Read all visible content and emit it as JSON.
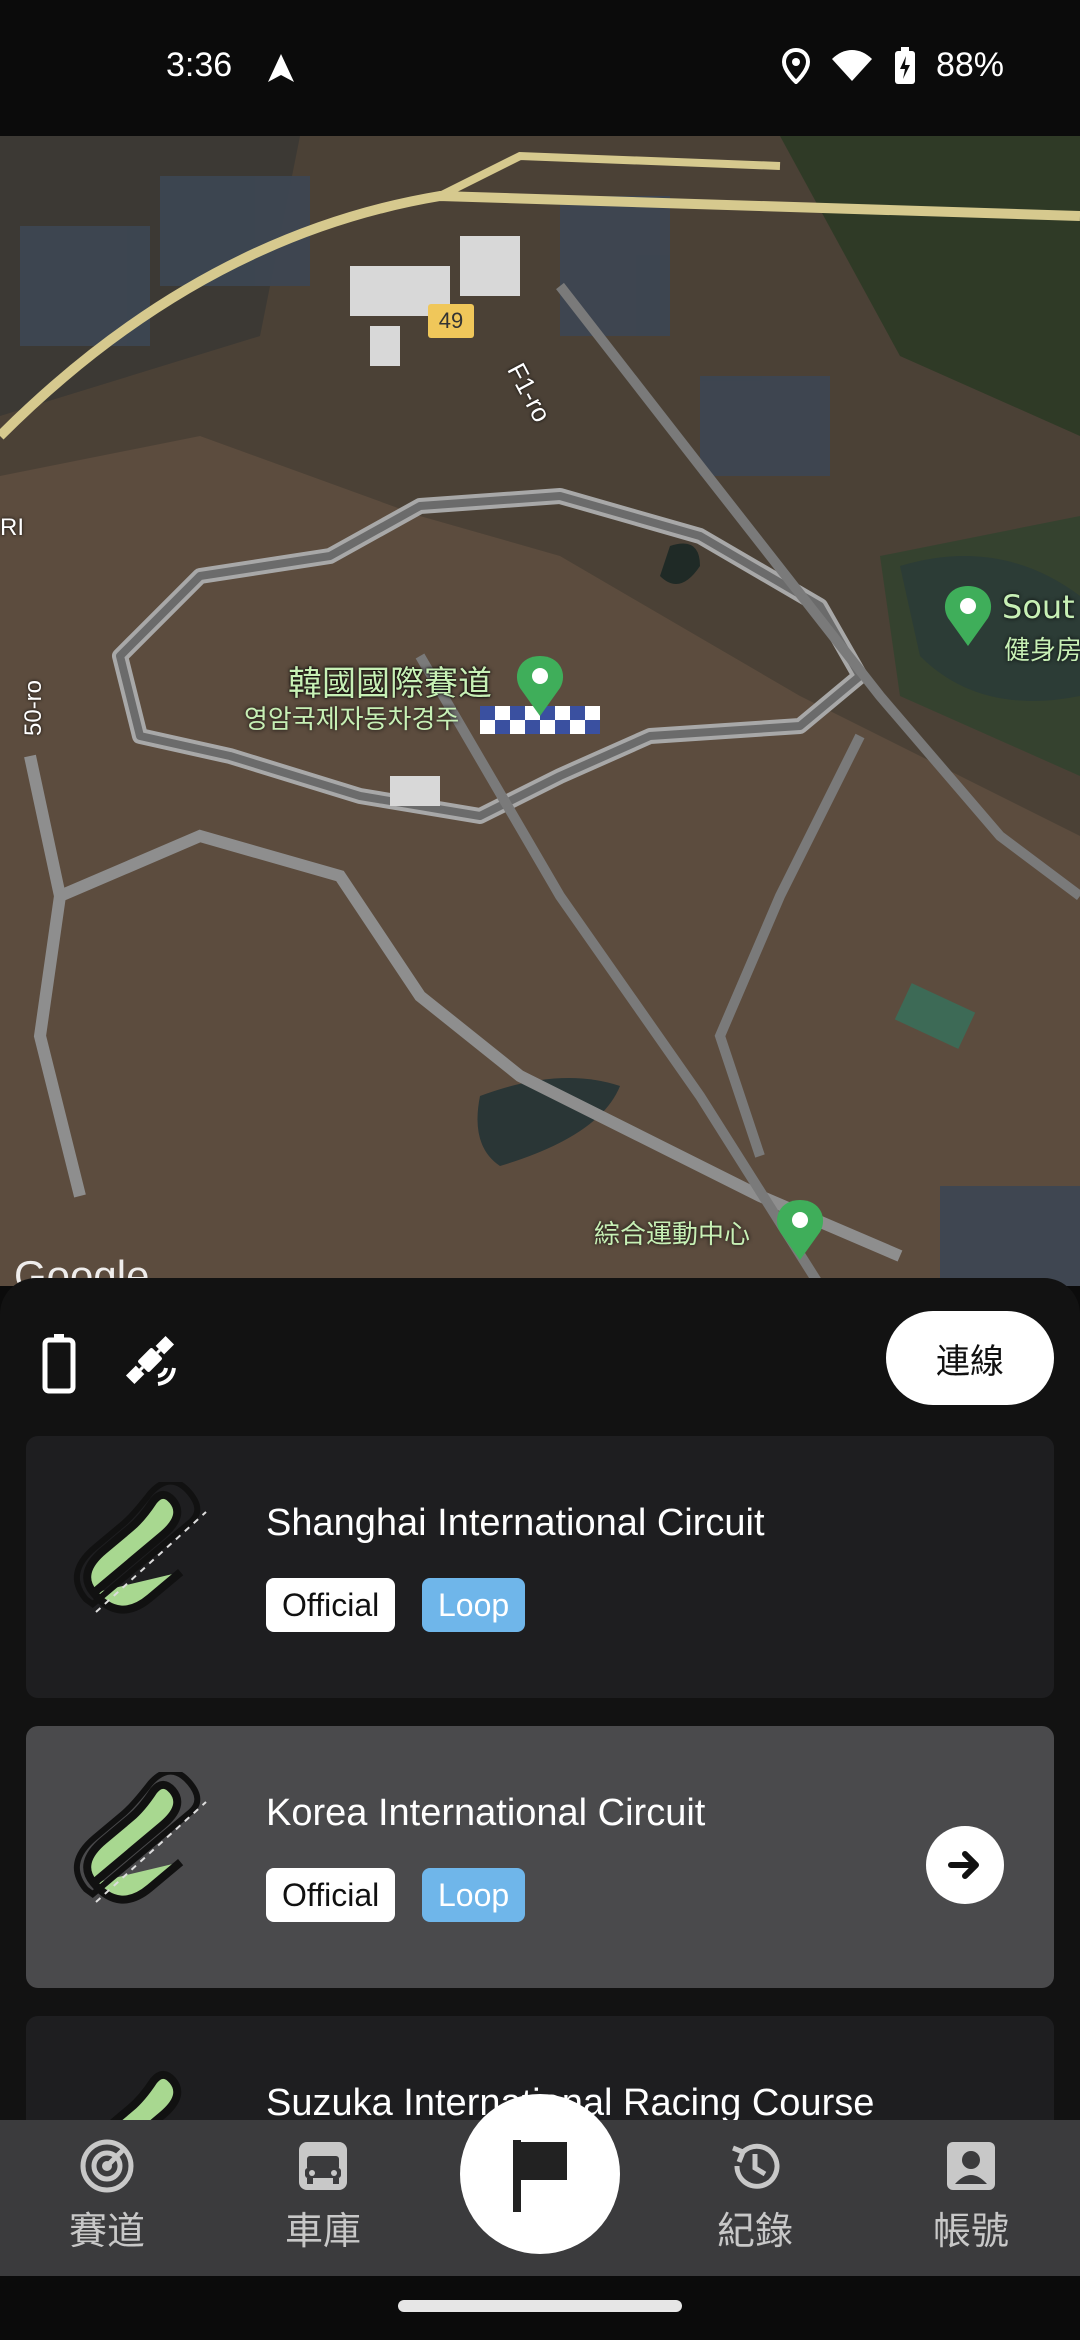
{
  "status_bar": {
    "time": "3:36",
    "battery_percent": "88%",
    "icons": [
      "navigation-arrow-icon",
      "location-icon",
      "wifi-icon",
      "battery-charging-icon"
    ]
  },
  "map": {
    "place_label_chinese": "韓國國際賽道",
    "place_label_korean": "영암국제자동차경주",
    "start_label": "START",
    "sports_center_label": "綜合運動中心",
    "south_label": "Sout",
    "south_label_chinese": "健身房",
    "road_49": "49",
    "road_f1": "F1-ro",
    "road_left": "50-ro",
    "road_ri": "RI",
    "logo": "Google"
  },
  "toolbar": {
    "connect_label": "連線",
    "icons": [
      "battery-icon",
      "satellite-icon"
    ]
  },
  "tracks": [
    {
      "name": "Shanghai International Circuit",
      "tag_official": "Official",
      "tag_loop": "Loop",
      "selected": false
    },
    {
      "name": "Korea International Circuit",
      "tag_official": "Official",
      "tag_loop": "Loop",
      "selected": true
    },
    {
      "name": "Suzuka International Racing Course",
      "tag_official": "",
      "tag_loop": "",
      "selected": false
    }
  ],
  "bottom_nav": {
    "items": [
      {
        "label": "賽道",
        "icon": "track-radar-icon"
      },
      {
        "label": "車庫",
        "icon": "garage-car-icon"
      },
      {
        "label": "",
        "icon": "flag-icon"
      },
      {
        "label": "紀錄",
        "icon": "history-icon"
      },
      {
        "label": "帳號",
        "icon": "account-icon"
      }
    ]
  },
  "colors": {
    "tag_loop": "#6fb6ea",
    "card_bg": "#1e1e20",
    "card_selected_bg": "#4a4a4c",
    "nav_bg": "#3b3b3d"
  }
}
